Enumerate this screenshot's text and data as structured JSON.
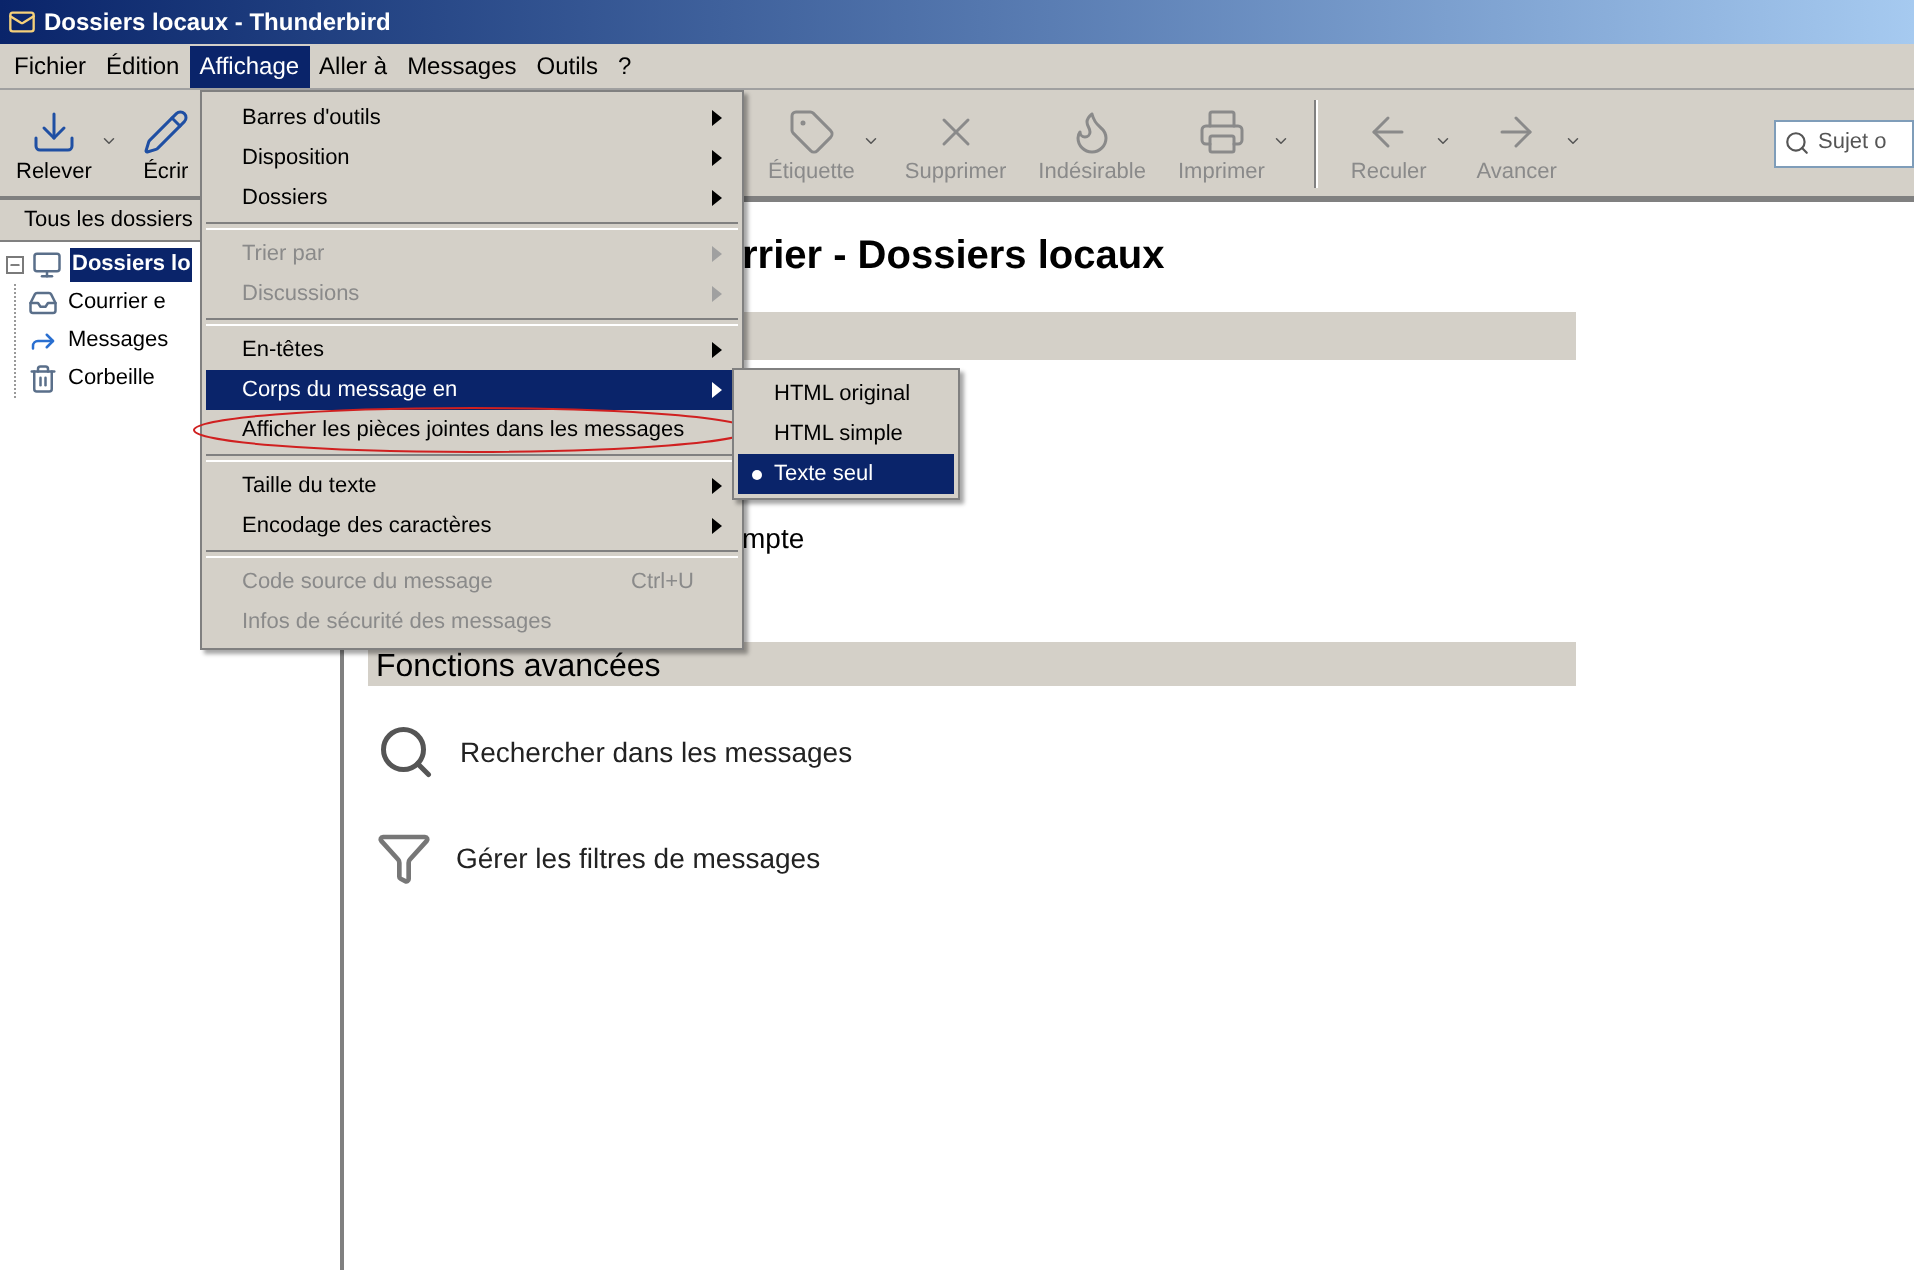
{
  "window": {
    "title": "Dossiers locaux - Thunderbird"
  },
  "menubar": [
    {
      "label": "Fichier",
      "selected": false
    },
    {
      "label": "Édition",
      "selected": false
    },
    {
      "label": "Affichage",
      "selected": true
    },
    {
      "label": "Aller à",
      "selected": false
    },
    {
      "label": "Messages",
      "selected": false
    },
    {
      "label": "Outils",
      "selected": false
    },
    {
      "label": "?",
      "selected": false
    }
  ],
  "toolbar": {
    "left": [
      {
        "kind": "get",
        "label": "Relever",
        "disabled": false,
        "dropdown": true
      },
      {
        "kind": "write",
        "label": "Écrir",
        "disabled": false
      }
    ],
    "right": [
      {
        "kind": "tag",
        "label": "Étiquette",
        "disabled": true,
        "dropdown": true
      },
      {
        "kind": "delete",
        "label": "Supprimer",
        "disabled": true,
        "dropdown": false
      },
      {
        "kind": "junk",
        "label": "Indésirable",
        "disabled": true,
        "dropdown": false
      },
      {
        "kind": "print",
        "label": "Imprimer",
        "disabled": true,
        "dropdown": true
      },
      {
        "kind": "separator"
      },
      {
        "kind": "back",
        "label": "Reculer",
        "disabled": true,
        "dropdown": true
      },
      {
        "kind": "forward",
        "label": "Avancer",
        "disabled": true,
        "dropdown": true
      }
    ],
    "search": {
      "placeholder": "Sujet o"
    }
  },
  "folder_pane": {
    "header": "Tous les dossiers",
    "tree": [
      {
        "kind": "computer",
        "label": "Dossiers lo",
        "selected": true,
        "expanded": true,
        "children": [
          {
            "kind": "outbox",
            "label": "Courrier e",
            "selected": false
          },
          {
            "kind": "sent",
            "label": "Messages",
            "selected": false
          },
          {
            "kind": "trash",
            "label": "Corbeille",
            "selected": false
          }
        ]
      }
    ]
  },
  "content": {
    "heading": "rrier - Dossiers locaux",
    "line": "mpte",
    "section": "Fonctions avancées",
    "actions": [
      {
        "kind": "search",
        "label": "Rechercher dans les messages"
      },
      {
        "kind": "filter",
        "label": "Gérer les filtres de messages"
      }
    ]
  },
  "menu": {
    "items": [
      {
        "kind": "item",
        "label": "Barres d'outils",
        "disabled": false,
        "selected": false,
        "submenu": true
      },
      {
        "kind": "item",
        "label": "Disposition",
        "disabled": false,
        "selected": false,
        "submenu": true
      },
      {
        "kind": "item",
        "label": "Dossiers",
        "disabled": false,
        "selected": false,
        "submenu": true
      },
      {
        "kind": "separator"
      },
      {
        "kind": "item",
        "label": "Trier par",
        "disabled": true,
        "selected": false,
        "submenu": true
      },
      {
        "kind": "item",
        "label": "Discussions",
        "disabled": true,
        "selected": false,
        "submenu": true
      },
      {
        "kind": "separator"
      },
      {
        "kind": "item",
        "label": "En-têtes",
        "disabled": false,
        "selected": false,
        "submenu": true
      },
      {
        "kind": "item",
        "label": "Corps du message en",
        "disabled": false,
        "selected": true,
        "submenu": true
      },
      {
        "kind": "item",
        "label": "Afficher les pièces jointes dans les messages",
        "disabled": false,
        "selected": false,
        "submenu": false,
        "circled": true
      },
      {
        "kind": "separator"
      },
      {
        "kind": "item",
        "label": "Taille du texte",
        "disabled": false,
        "selected": false,
        "submenu": true
      },
      {
        "kind": "item",
        "label": "Encodage des caractères",
        "disabled": false,
        "selected": false,
        "submenu": true
      },
      {
        "kind": "separator"
      },
      {
        "kind": "item",
        "label": "Code source du message",
        "disabled": true,
        "selected": false,
        "submenu": false,
        "shortcut": "Ctrl+U"
      },
      {
        "kind": "item",
        "label": "Infos de sécurité des messages",
        "disabled": true,
        "selected": false,
        "submenu": false
      }
    ]
  },
  "submenu": {
    "items": [
      {
        "label": "HTML original",
        "selected": false,
        "checked": false
      },
      {
        "label": "HTML simple",
        "selected": false,
        "checked": false
      },
      {
        "label": "Texte seul",
        "selected": true,
        "checked": true
      }
    ]
  }
}
